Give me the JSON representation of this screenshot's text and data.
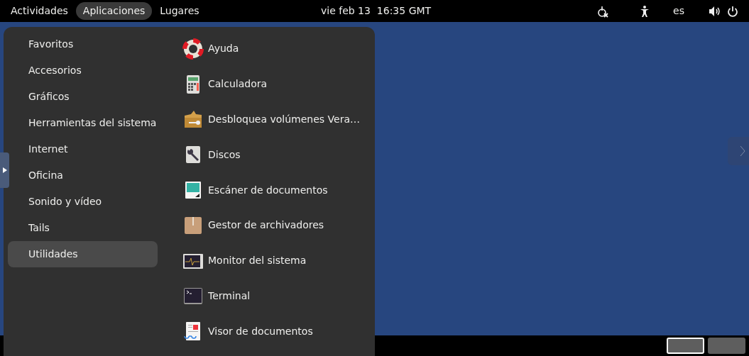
{
  "top_bar": {
    "items": [
      {
        "label": "Actividades",
        "selected": false
      },
      {
        "label": "Aplicaciones",
        "selected": true
      },
      {
        "label": "Lugares",
        "selected": false
      }
    ],
    "clock": "vie feb 13  16:35 GMT",
    "language": "es"
  },
  "applications_menu": {
    "categories": [
      {
        "label": "Favoritos",
        "selected": false
      },
      {
        "label": "Accesorios",
        "selected": false
      },
      {
        "label": "Gráficos",
        "selected": false
      },
      {
        "label": "Herramientas del sistema",
        "selected": false
      },
      {
        "label": "Internet",
        "selected": false
      },
      {
        "label": "Oficina",
        "selected": false
      },
      {
        "label": "Sonido y vídeo",
        "selected": false
      },
      {
        "label": "Tails",
        "selected": false
      },
      {
        "label": "Utilidades",
        "selected": true
      }
    ],
    "apps": [
      {
        "label": "Ayuda",
        "kind": "help"
      },
      {
        "label": "Calculadora",
        "kind": "calculator"
      },
      {
        "label": "Desbloquea volúmenes Vera…",
        "kind": "unlock"
      },
      {
        "label": "Discos",
        "kind": "disks"
      },
      {
        "label": "Escáner de documentos",
        "kind": "scanner"
      },
      {
        "label": "Gestor de archivadores",
        "kind": "archive"
      },
      {
        "label": "Monitor del sistema",
        "kind": "monitor"
      },
      {
        "label": "Terminal",
        "kind": "terminal"
      },
      {
        "label": "Visor de documentos",
        "kind": "viewer"
      }
    ]
  },
  "workspaces": [
    {
      "selected": true
    },
    {
      "selected": false
    }
  ]
}
